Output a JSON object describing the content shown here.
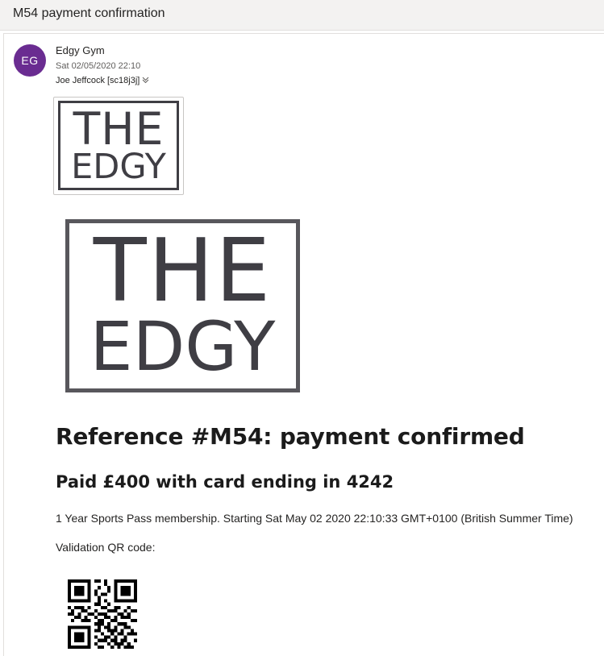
{
  "email": {
    "subject": "M54 payment confirmation",
    "sender": {
      "initials": "EG",
      "name": "Edgy Gym",
      "date": "Sat 02/05/2020 22:10",
      "avatar_color": "#6a2c91"
    },
    "recipient": "Joe Jeffcock [sc18j3j]",
    "recipient_expand_icon": "chevron-down-icon"
  },
  "body": {
    "logo_small": {
      "line1": "THE",
      "line2": "EDGY"
    },
    "logo_big": {
      "line1": "THE",
      "line2": "EDGY"
    },
    "heading": "Reference #M54: payment confirmed",
    "subheading": "Paid £400 with card ending in 4242",
    "description": "1 Year Sports Pass membership. Starting Sat May 02 2020 22:10:33 GMT+0100 (British Summer Time)",
    "qr_label": "Validation QR code:"
  },
  "colors": {
    "logo_text": "#3f3e44",
    "subject_bar": "#f3f2f1"
  }
}
